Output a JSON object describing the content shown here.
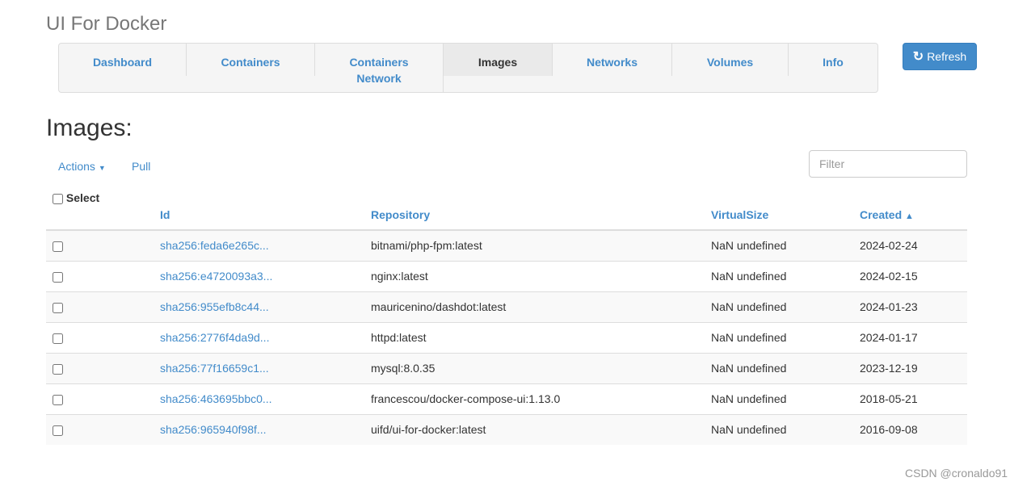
{
  "app_title": "UI For Docker",
  "nav": {
    "tabs": [
      {
        "label": "Dashboard"
      },
      {
        "label": "Containers"
      },
      {
        "label": "Containers Network"
      },
      {
        "label": "Images",
        "active": true
      },
      {
        "label": "Networks"
      },
      {
        "label": "Volumes"
      },
      {
        "label": "Info"
      }
    ]
  },
  "refresh_label": "Refresh",
  "page_title": "Images:",
  "actions_label": "Actions",
  "pull_label": "Pull",
  "filter_placeholder": "Filter",
  "table": {
    "headers": {
      "select": "Select",
      "id": "Id",
      "repository": "Repository",
      "size": "VirtualSize",
      "created": "Created"
    },
    "rows": [
      {
        "id": "sha256:feda6e265c...",
        "repo": "bitnami/php-fpm:latest",
        "size": "NaN undefined",
        "created": "2024-02-24"
      },
      {
        "id": "sha256:e4720093a3...",
        "repo": "nginx:latest",
        "size": "NaN undefined",
        "created": "2024-02-15"
      },
      {
        "id": "sha256:955efb8c44...",
        "repo": "mauricenino/dashdot:latest",
        "size": "NaN undefined",
        "created": "2024-01-23"
      },
      {
        "id": "sha256:2776f4da9d...",
        "repo": "httpd:latest",
        "size": "NaN undefined",
        "created": "2024-01-17"
      },
      {
        "id": "sha256:77f16659c1...",
        "repo": "mysql:8.0.35",
        "size": "NaN undefined",
        "created": "2023-12-19"
      },
      {
        "id": "sha256:463695bbc0...",
        "repo": "francescou/docker-compose-ui:1.13.0",
        "size": "NaN undefined",
        "created": "2018-05-21"
      },
      {
        "id": "sha256:965940f98f...",
        "repo": "uifd/ui-for-docker:latest",
        "size": "NaN undefined",
        "created": "2016-09-08"
      }
    ]
  },
  "watermark": "CSDN @cronaldo91"
}
